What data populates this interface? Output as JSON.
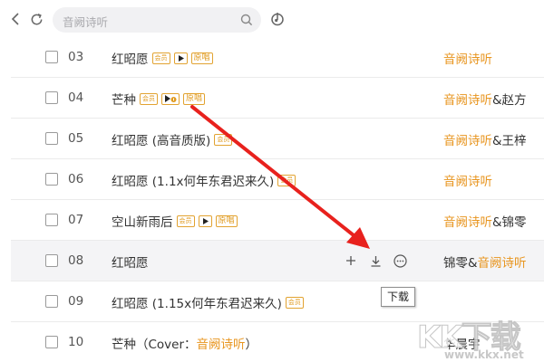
{
  "search": {
    "placeholder": "音阙诗听"
  },
  "tooltip": {
    "text": "下载"
  },
  "tags": {
    "vip": "会员",
    "mv": "▶",
    "original": "原唱"
  },
  "songs": [
    {
      "num": "03",
      "title": "红昭愿",
      "tags": [
        "vip",
        "mv",
        "original"
      ],
      "artist_plain_before": "",
      "artist_hl": "音阙诗听",
      "artist_plain_after": ""
    },
    {
      "num": "04",
      "title": "芒种",
      "tags": [
        "vip",
        "mv-music",
        "original"
      ],
      "artist_plain_before": "",
      "artist_hl": "音阙诗听",
      "artist_plain_after": "&赵方"
    },
    {
      "num": "05",
      "title": "红昭愿 (高音质版)",
      "tags": [
        "vip"
      ],
      "artist_plain_before": "",
      "artist_hl": "音阙诗听",
      "artist_plain_after": "&王梓"
    },
    {
      "num": "06",
      "title": "红昭愿 (1.1x何年东君迟来久)",
      "tags": [
        "vip"
      ],
      "artist_plain_before": "",
      "artist_hl": "音阙诗听",
      "artist_plain_after": ""
    },
    {
      "num": "07",
      "title": "空山新雨后",
      "tags": [
        "vip",
        "mv",
        "original"
      ],
      "artist_plain_before": "",
      "artist_hl": "音阙诗听",
      "artist_plain_after": "&锦零"
    },
    {
      "num": "08",
      "title": "红昭愿",
      "tags": [],
      "artist_plain_before": "锦零&",
      "artist_hl": "音阙诗听",
      "artist_plain_after": "",
      "hover": true
    },
    {
      "num": "09",
      "title": "红昭愿 (1.15x何年东君迟来久)",
      "tags": [
        "vip"
      ],
      "artist_plain_before": "",
      "artist_hl": "",
      "artist_plain_after": ""
    },
    {
      "num": "10",
      "title_plain": "芒种（Cover：",
      "title_hl": "音阙诗听",
      "title_end": "）",
      "tags": [],
      "artist_plain_before": "华晨宇",
      "artist_hl": "",
      "artist_plain_after": ""
    }
  ],
  "watermark": {
    "logo": "KK下载",
    "url": "www.kkx.net"
  },
  "colors": {
    "accent": "#e8951f",
    "annotation_arrow": "#e8211d",
    "hover_row": "#f4f4f6"
  }
}
